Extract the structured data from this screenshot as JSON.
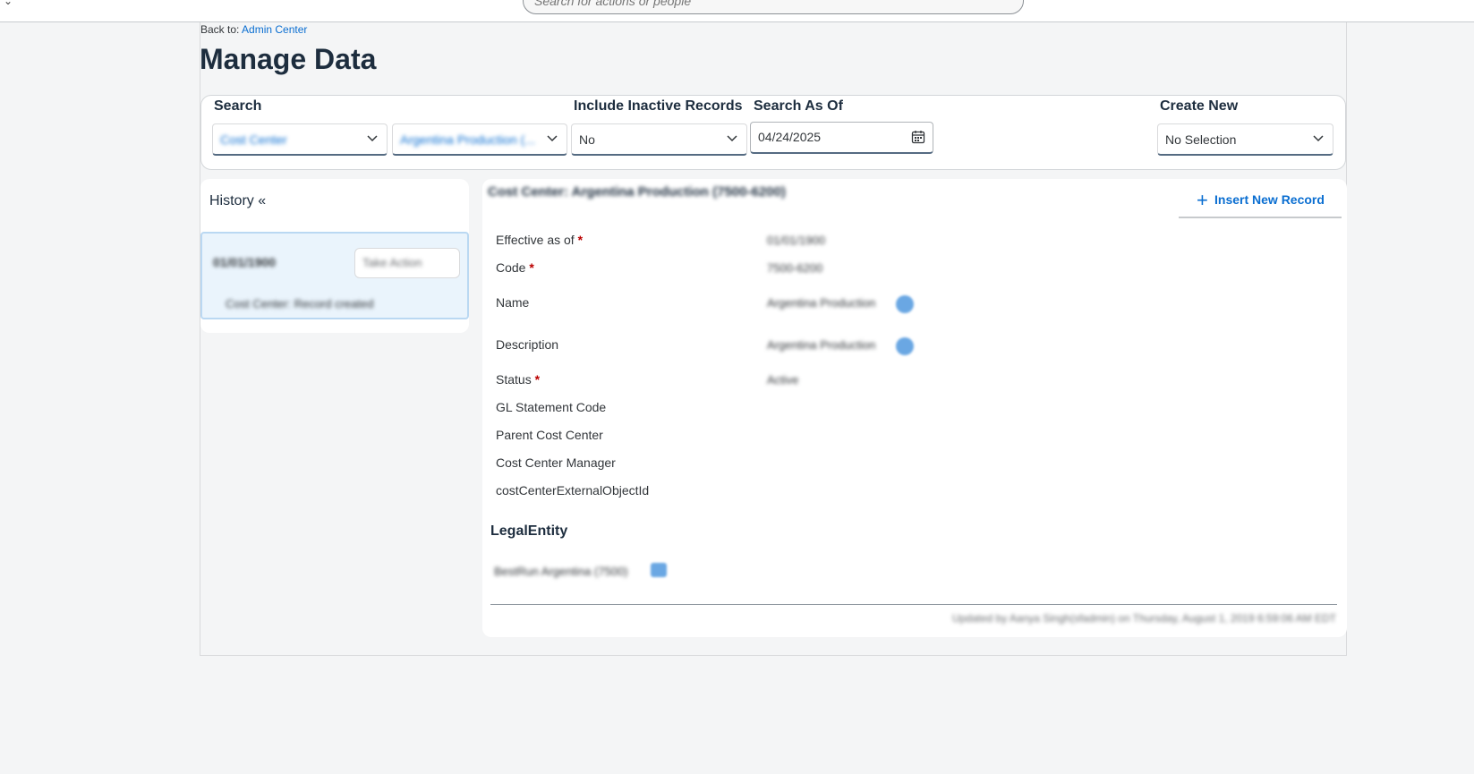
{
  "topbar": {
    "search_placeholder": "Search for actions or people"
  },
  "breadcrumb": {
    "prefix": "Back to:",
    "link": "Admin Center"
  },
  "page": {
    "title": "Manage Data"
  },
  "search": {
    "search_label": "Search",
    "object_type_value": "Cost Center",
    "object_value": "Argentina Production (...",
    "inactive_label": "Include Inactive Records",
    "inactive_value": "No",
    "as_of_label": "Search As Of",
    "as_of_value": "04/24/2025",
    "create_new_label": "Create New",
    "create_new_value": "No Selection"
  },
  "history": {
    "title": "History «",
    "entry_date": "01/01/1900",
    "entry_action": "Take Action",
    "entry_note": "Cost Center: Record created"
  },
  "detail": {
    "title": "Cost Center: Argentina Production (7500-6200)",
    "insert_label": "Insert New Record",
    "fields": [
      {
        "label": "Effective as of",
        "required": "*",
        "value": "01/01/1900"
      },
      {
        "label": "Code",
        "required": "*",
        "value": "7500-6200"
      },
      {
        "label": "Name",
        "required": "",
        "value": "Argentina Production"
      },
      {
        "label": "Description",
        "required": "",
        "value": "Argentina Production"
      },
      {
        "label": "Status",
        "required": "*",
        "value": "Active"
      },
      {
        "label": "GL Statement Code",
        "required": "",
        "value": ""
      },
      {
        "label": "Parent Cost Center",
        "required": "",
        "value": ""
      },
      {
        "label": "Cost Center Manager",
        "required": "",
        "value": ""
      },
      {
        "label": "costCenterExternalObjectId",
        "required": "",
        "value": ""
      }
    ],
    "legal_section_title": "LegalEntity",
    "legal_value": "BestRun Argentina (7500)",
    "footer": "Updated by Aanya Singh(sfadmin) on Thursday, August 1, 2019 6:59:06 AM EDT"
  },
  "colors": {
    "accent": "#0a6ed1",
    "title": "#1d2d3e",
    "required": "#bb0000"
  }
}
